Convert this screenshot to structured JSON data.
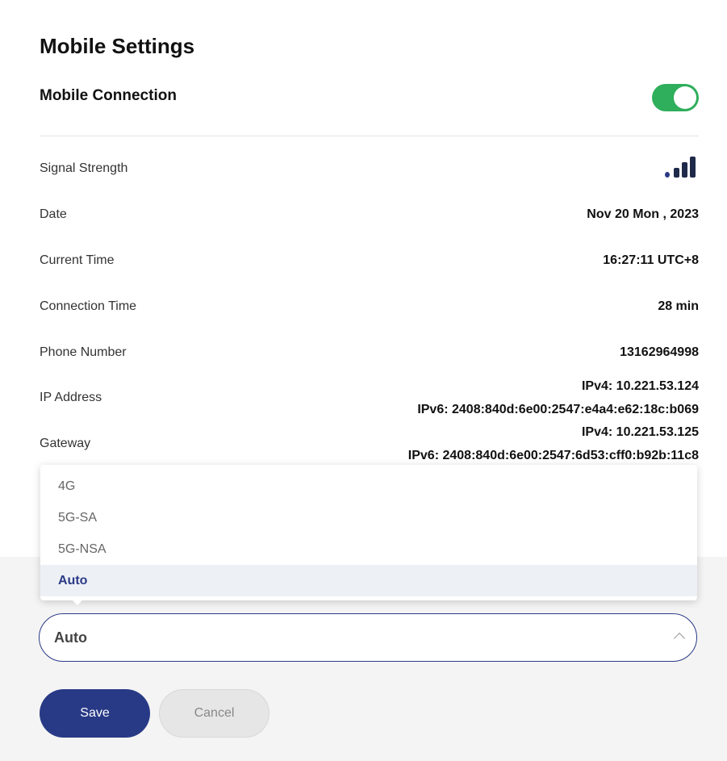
{
  "page": {
    "title": "Mobile Settings"
  },
  "mobile_connection": {
    "label": "Mobile Connection",
    "enabled": true,
    "toggle_color": "#2fae5b"
  },
  "info": {
    "signal_strength": {
      "label": "Signal Strength",
      "bars_active": 3,
      "bars_total": 4,
      "icon": "signal-bars-icon"
    },
    "date": {
      "label": "Date",
      "value": "Nov 20 Mon , 2023"
    },
    "current_time": {
      "label": "Current Time",
      "value": "16:27:11 UTC+8"
    },
    "connection_time": {
      "label": "Connection Time",
      "value": "28 min"
    },
    "phone_number": {
      "label": "Phone Number",
      "value": "13162964998"
    },
    "ip_address": {
      "label": "IP Address",
      "ipv4": "IPv4: 10.221.53.124",
      "ipv6": "IPv6: 2408:840d:6e00:2547:e4a4:e62:18c:b069"
    },
    "gateway": {
      "label": "Gateway",
      "ipv4": "IPv4: 10.221.53.125",
      "ipv6": "IPv6: 2408:840d:6e00:2547:6d53:cff0:b92b:11c8"
    }
  },
  "network_mode": {
    "options": [
      "4G",
      "5G-SA",
      "5G-NSA",
      "Auto"
    ],
    "selected": "Auto",
    "icon": "chevron-up-icon"
  },
  "actions": {
    "save_label": "Save",
    "cancel_label": "Cancel"
  },
  "colors": {
    "primary": "#283a86",
    "selected_bg": "#edf1f6"
  }
}
